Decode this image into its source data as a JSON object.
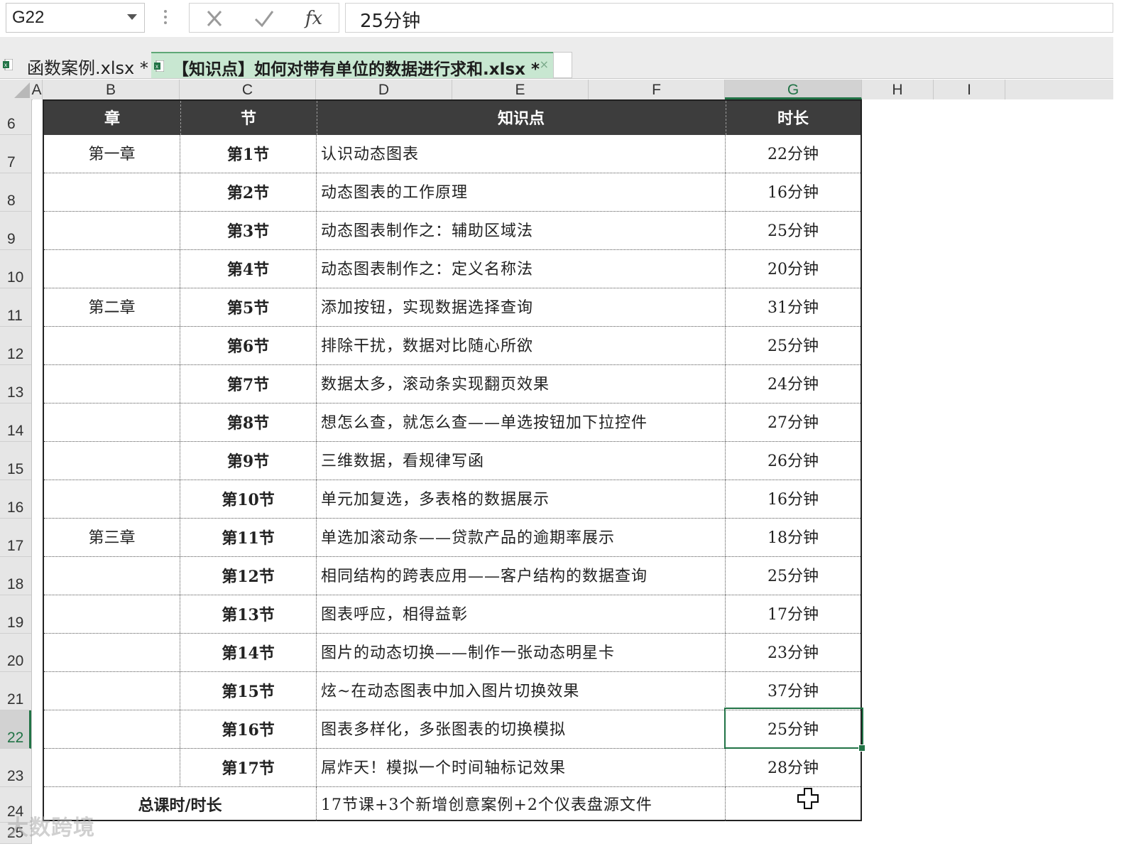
{
  "formula_bar": {
    "name_box": "G22",
    "cancel_symbol": "✕",
    "enter_symbol": "✓",
    "fx_label": "fx",
    "formula_value": "25分钟"
  },
  "tabs": [
    {
      "label": "函数案例.xlsx *"
    },
    {
      "label": "【知识点】如何对带有单位的数据进行求和.xlsx *",
      "close": "×"
    }
  ],
  "columns": [
    "A",
    "B",
    "C",
    "D",
    "E",
    "F",
    "G",
    "H",
    "I"
  ],
  "selected_column": "G",
  "rows": [
    "6",
    "7",
    "8",
    "9",
    "10",
    "11",
    "12",
    "13",
    "14",
    "15",
    "16",
    "17",
    "18",
    "19",
    "20",
    "21",
    "22",
    "23",
    "24",
    "25"
  ],
  "selected_row": "22",
  "table": {
    "headers": {
      "chapter": "章",
      "section": "节",
      "topic": "知识点",
      "duration": "时长"
    },
    "rows": [
      {
        "chapter": "第一章",
        "section": "第1节",
        "topic": "认识动态图表",
        "duration": "22分钟"
      },
      {
        "chapter": "",
        "section": "第2节",
        "topic": "动态图表的工作原理",
        "duration": "16分钟"
      },
      {
        "chapter": "",
        "section": "第3节",
        "topic": "动态图表制作之：辅助区域法",
        "duration": "25分钟"
      },
      {
        "chapter": "",
        "section": "第4节",
        "topic": "动态图表制作之：定义名称法",
        "duration": "20分钟"
      },
      {
        "chapter": "第二章",
        "section": "第5节",
        "topic": "添加按钮，实现数据选择查询",
        "duration": "31分钟"
      },
      {
        "chapter": "",
        "section": "第6节",
        "topic": "排除干扰，数据对比随心所欲",
        "duration": "25分钟"
      },
      {
        "chapter": "",
        "section": "第7节",
        "topic": "数据太多，滚动条实现翻页效果",
        "duration": "24分钟"
      },
      {
        "chapter": "",
        "section": "第8节",
        "topic": "想怎么查，就怎么查——单选按钮加下拉控件",
        "duration": "27分钟"
      },
      {
        "chapter": "",
        "section": "第9节",
        "topic": "三维数据，看规律写函",
        "duration": "26分钟"
      },
      {
        "chapter": "",
        "section": "第10节",
        "topic": "单元加复选，多表格的数据展示",
        "duration": "16分钟"
      },
      {
        "chapter": "第三章",
        "section": "第11节",
        "topic": "单选加滚动条——贷款产品的逾期率展示",
        "duration": "18分钟"
      },
      {
        "chapter": "",
        "section": "第12节",
        "topic": "相同结构的跨表应用——客户结构的数据查询",
        "duration": "25分钟"
      },
      {
        "chapter": "",
        "section": "第13节",
        "topic": "图表呼应，相得益彰",
        "duration": "17分钟"
      },
      {
        "chapter": "",
        "section": "第14节",
        "topic": "图片的动态切换——制作一张动态明星卡",
        "duration": "23分钟"
      },
      {
        "chapter": "",
        "section": "第15节",
        "topic": "炫~在动态图表中加入图片切换效果",
        "duration": "37分钟"
      },
      {
        "chapter": "",
        "section": "第16节",
        "topic": "图表多样化，多张图表的切换模拟",
        "duration": "25分钟"
      },
      {
        "chapter": "",
        "section": "第17节",
        "topic": "屌炸天！模拟一个时间轴标记效果",
        "duration": "28分钟"
      }
    ],
    "total": {
      "label": "总课时/时长",
      "summary": "17节课+3个新增创意案例+2个仪表盘源文件",
      "duration": ""
    }
  },
  "watermark": "大数跨境",
  "colors": {
    "accent": "#217346",
    "header_bg": "#3d3d3d",
    "active_tab": "#c8e7d1"
  }
}
